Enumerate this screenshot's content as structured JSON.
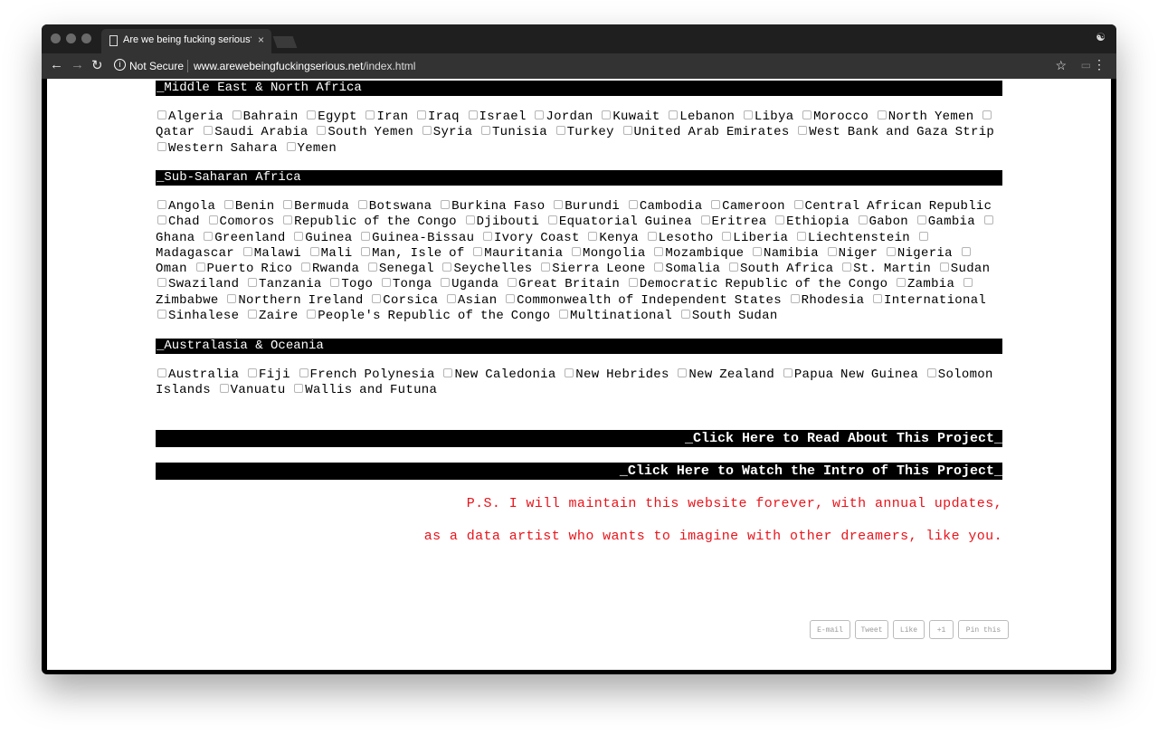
{
  "browser": {
    "tab_title": "Are we being fucking serious?",
    "close_glyph": "×",
    "security_label": "Not Secure",
    "url_domain": "www.arewebeingfuckingserious.net",
    "url_path": "/index.html",
    "icons": [
      "doc-icon",
      "close-icon",
      "back-icon",
      "forward-icon",
      "reload-icon",
      "info-icon",
      "star-icon",
      "cast-icon",
      "menu-icon",
      "profile-icon"
    ]
  },
  "sections": {
    "mena": {
      "title": "_Middle East & North Africa",
      "countries": [
        "Algeria",
        "Bahrain",
        "Egypt",
        "Iran",
        "Iraq",
        "Israel",
        "Jordan",
        "Kuwait",
        "Lebanon",
        "Libya",
        "Morocco",
        "North Yemen",
        "Qatar",
        "Saudi Arabia",
        "South Yemen",
        "Syria",
        "Tunisia",
        "Turkey",
        "United Arab Emirates",
        "West Bank and Gaza Strip",
        "Western Sahara",
        "Yemen"
      ]
    },
    "ssa": {
      "title": "_Sub-Saharan Africa",
      "countries": [
        "Angola",
        "Benin",
        "Bermuda",
        "Botswana",
        "Burkina Faso",
        "Burundi",
        "Cambodia",
        "Cameroon",
        "Central African Republic",
        "Chad",
        "Comoros",
        "Republic of the Congo",
        "Djibouti",
        "Equatorial Guinea",
        "Eritrea",
        "Ethiopia",
        "Gabon",
        "Gambia",
        "Ghana",
        "Greenland",
        "Guinea",
        "Guinea-Bissau",
        "Ivory Coast",
        "Kenya",
        "Lesotho",
        "Liberia",
        "Liechtenstein",
        "Madagascar",
        "Malawi",
        "Mali",
        "Man, Isle of",
        "Mauritania",
        "Mongolia",
        "Mozambique",
        "Namibia",
        "Niger",
        "Nigeria",
        "Oman",
        "Puerto Rico",
        "Rwanda",
        "Senegal",
        "Seychelles",
        "Sierra Leone",
        "Somalia",
        "South Africa",
        "St. Martin",
        "Sudan",
        "Swaziland",
        "Tanzania",
        "Togo",
        "Tonga",
        "Uganda",
        "Great Britain",
        "Democratic Republic of the Congo",
        "Zambia",
        "Zimbabwe",
        "Northern Ireland",
        "Corsica",
        "Asian",
        "Commonwealth of Independent States",
        "Rhodesia",
        "International",
        "Sinhalese",
        "Zaire",
        "People's Republic of the Congo",
        "Multinational",
        "South Sudan"
      ]
    },
    "oceania": {
      "title": "_Australasia & Oceania",
      "countries": [
        "Australia",
        "Fiji",
        "French Polynesia",
        "New Caledonia",
        "New Hebrides",
        "New Zealand",
        "Papua New Guinea",
        "Solomon Islands",
        "Vanuatu",
        "Wallis and Futuna"
      ]
    }
  },
  "links": {
    "read_about": "_Click Here to Read About This Project_",
    "watch_intro": "_Click Here to Watch the Intro of This Project_"
  },
  "ps": {
    "line1": "P.S. I will maintain this website forever, with annual updates,",
    "line2": "as a data artist who wants to imagine with other dreamers, like you."
  },
  "share": [
    "E-mail",
    "Tweet",
    "Like",
    "+1",
    "Pin this"
  ],
  "colors": {
    "ps_text": "#e8141b",
    "bar_bg": "#000000",
    "bar_text": "#ffffff"
  }
}
